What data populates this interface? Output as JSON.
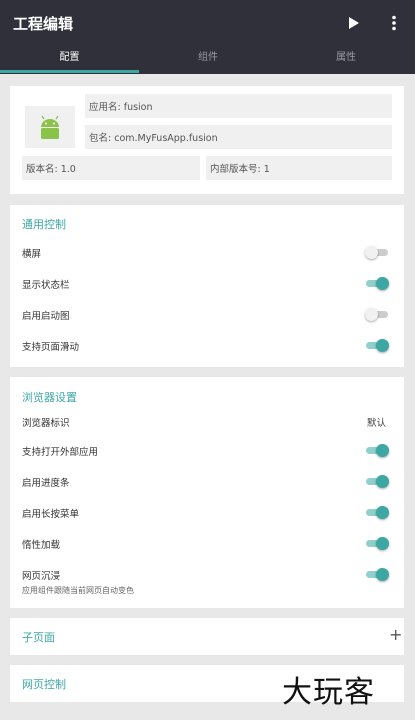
{
  "appbar": {
    "title": "工程编辑",
    "play_icon": "play-icon",
    "more_icon": "more-vert-icon"
  },
  "tabs": [
    {
      "label": "配置",
      "active": true
    },
    {
      "label": "组件",
      "active": false
    },
    {
      "label": "属性",
      "active": false
    }
  ],
  "project": {
    "icon": "android-icon",
    "app_name": "应用名: fusion",
    "package_name": "包名: com.MyFusApp.fusion",
    "version_name": "版本名: 1.0",
    "version_code": "内部版本号: 1"
  },
  "general": {
    "title": "通用控制",
    "items": [
      {
        "label": "横屏",
        "on": false
      },
      {
        "label": "显示状态栏",
        "on": true
      },
      {
        "label": "启用启动图",
        "on": false
      },
      {
        "label": "支持页面滑动",
        "on": true
      }
    ]
  },
  "browser": {
    "title": "浏览器设置",
    "ua_label": "浏览器标识",
    "ua_value": "默认",
    "items": [
      {
        "label": "支持打开外部应用",
        "on": true
      },
      {
        "label": "启用进度条",
        "on": true
      },
      {
        "label": "启用长按菜单",
        "on": true
      },
      {
        "label": "惰性加载",
        "on": true
      },
      {
        "label": "网页沉浸",
        "on": true
      }
    ],
    "immersive_sub": "应用组件跟随当前网页自动变色"
  },
  "subpage": {
    "title": "子页面",
    "icon": "plus-icon"
  },
  "webcontrol": {
    "title": "网页控制"
  },
  "watermark": "大玩客",
  "colors": {
    "accent": "#3da7a4",
    "appbar": "#30303a",
    "background": "#e8e8e8"
  }
}
